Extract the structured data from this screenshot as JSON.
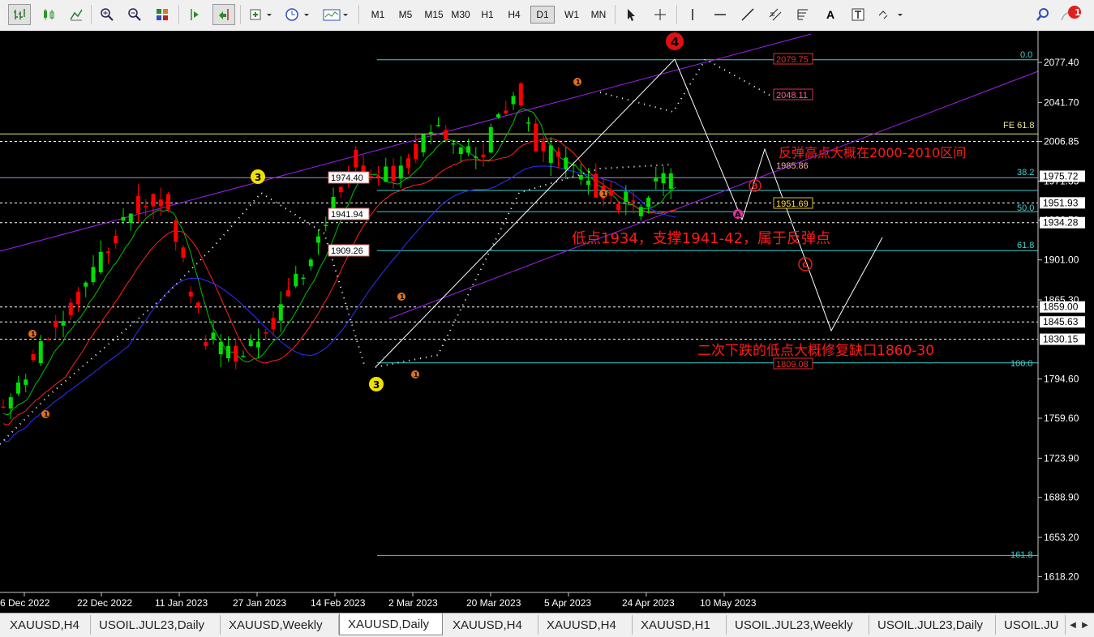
{
  "toolbar": {
    "timeframes": [
      "M1",
      "M5",
      "M15",
      "M30",
      "H1",
      "H4",
      "D1",
      "W1",
      "MN"
    ],
    "active_timeframe": "D1",
    "text_tool_label": "A",
    "notification_count": "1"
  },
  "chart": {
    "price_axis": [
      "2077.40",
      "2041.70",
      "2006.85",
      "1971.35",
      "1936.50",
      "1901.00",
      "1865.30",
      "1794.60",
      "1759.60",
      "1723.90",
      "1688.90",
      "1653.20",
      "1618.20"
    ],
    "time_axis": [
      "6 Dec 2022",
      "22 Dec 2022",
      "11 Jan 2023",
      "27 Jan 2023",
      "14 Feb 2023",
      "2 Mar 2023",
      "20 Mar 2023",
      "5 Apr 2023",
      "24 Apr 2023",
      "10 May 2023"
    ],
    "axis_badges": [
      {
        "label": "1975.72",
        "bg": "#ffffff"
      },
      {
        "label": "1951.93",
        "bg": "#ffffff"
      },
      {
        "label": "1934.28",
        "bg": "#ffffff"
      },
      {
        "label": "1859.00",
        "bg": "#ffffff"
      },
      {
        "label": "1845.63",
        "bg": "#ffffff"
      },
      {
        "label": "1830.15",
        "bg": "#ffffff"
      }
    ],
    "fib_labels": [
      "0.0",
      "FE 61.8",
      "38.2",
      "50.0",
      "61.8",
      "100.0",
      "161.8"
    ],
    "hline_labels": [
      "1974.40",
      "1941.94",
      "1909.26"
    ],
    "price_tags": [
      "2079.75",
      "2048.11",
      "1985.86",
      "1951.69",
      "1809.08"
    ],
    "wave_labels": {
      "w4": "4",
      "w3_top": "3",
      "w3_bottom": "3",
      "w1_a": "1",
      "w1_b": "1",
      "w1_c": "1",
      "w1_d": "1",
      "w1_e": "1",
      "w1_f": "1",
      "w_a": "A",
      "w_b": "B",
      "w_c": "C"
    },
    "annotations": {
      "rebound_high": "反弹高点大概在2000-2010区间",
      "low_support": "低点1934，支撑1941-42，属于反弹点",
      "second_drop": "二次下跌的低点大概修复缺口1860-30"
    },
    "colors": {
      "bull": "#00e000",
      "bear": "#ff0000",
      "ma_fast": "#00c000",
      "ma_mid": "#ff2020",
      "ma_slow": "#3030ff",
      "channel": "#a020f0",
      "fib": "#40d0d0",
      "annotation": "#ff1a1a"
    }
  },
  "tabs": [
    "XAUUSD,H4",
    "USOIL.JUL23,Daily",
    "XAUUSD,Weekly",
    "XAUUSD,Daily",
    "XAUUSD,H4",
    "XAUUSD,H4",
    "XAUUSD,H1",
    "USOIL.JUL23,Weekly",
    "USOIL.JUL23,Daily",
    "USOIL.JU"
  ],
  "active_tab": "XAUUSD,Daily"
}
